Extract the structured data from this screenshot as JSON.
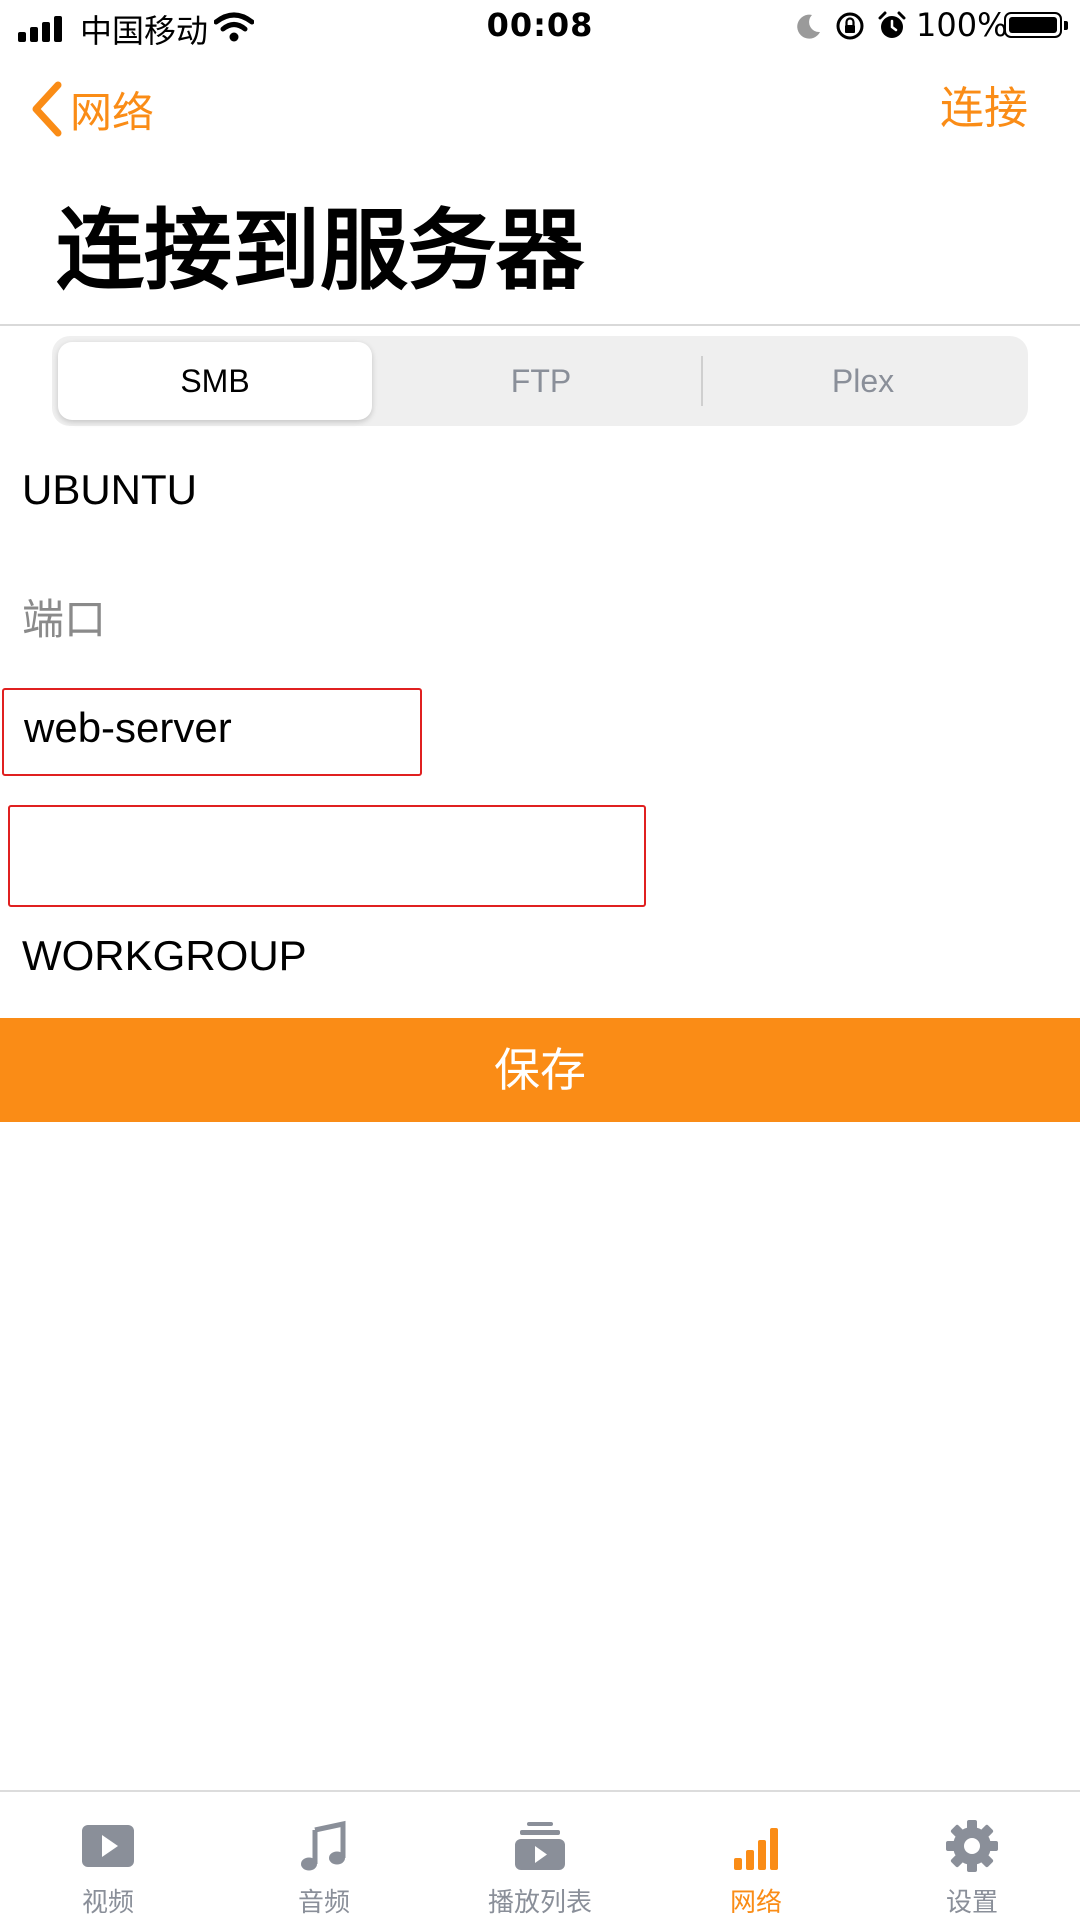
{
  "status_bar": {
    "carrier": "中国移动",
    "time": "00:08",
    "battery": "100%"
  },
  "nav": {
    "back_label": "网络",
    "connect_label": "连接"
  },
  "page": {
    "title": "连接到服务器"
  },
  "segments": {
    "items": [
      {
        "label": "SMB",
        "selected": true
      },
      {
        "label": "FTP",
        "selected": false
      },
      {
        "label": "Plex",
        "selected": false
      }
    ]
  },
  "form": {
    "server_value": "UBUNTU",
    "port_placeholder": "端口",
    "username_value": "web-server",
    "password_value": "",
    "workgroup_value": "WORKGROUP"
  },
  "save_label": "保存",
  "tabs": [
    {
      "label": "视频",
      "icon": "play-icon",
      "active": false
    },
    {
      "label": "音频",
      "icon": "music-note-icon",
      "active": false
    },
    {
      "label": "播放列表",
      "icon": "playlist-icon",
      "active": false
    },
    {
      "label": "网络",
      "icon": "signal-bars-icon",
      "active": true
    },
    {
      "label": "设置",
      "icon": "gear-icon",
      "active": false
    }
  ],
  "colors": {
    "accent": "#fa8c16",
    "tab_inactive": "#8a8f99",
    "highlight_border": "#e02020"
  }
}
